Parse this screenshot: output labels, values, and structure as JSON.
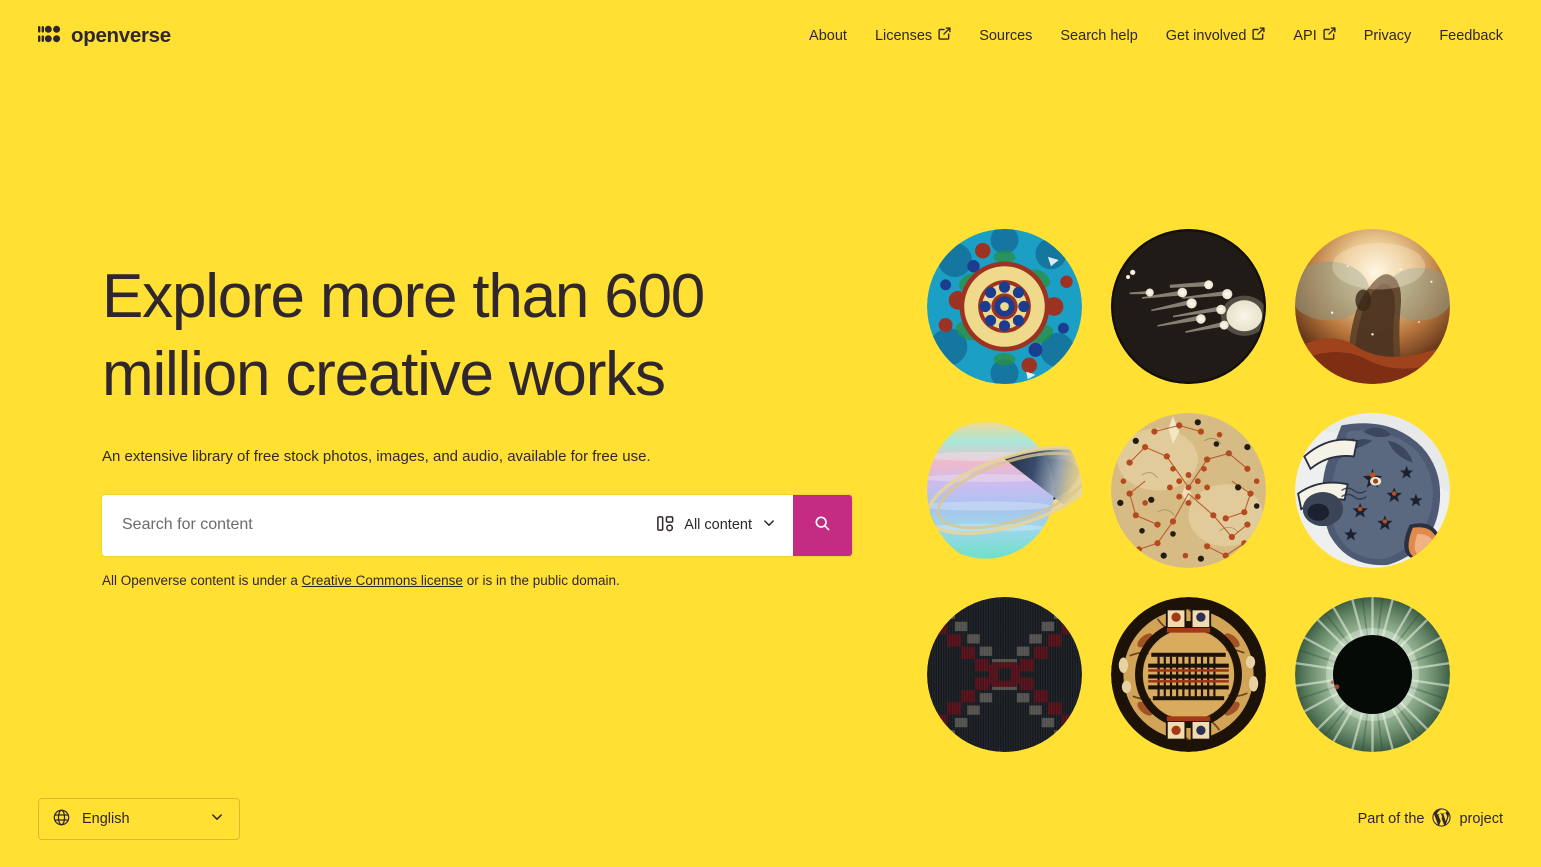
{
  "brand": {
    "name": "openverse",
    "logo_icon": "openverse-logo-icon"
  },
  "nav": {
    "items": [
      {
        "label": "About",
        "external": false
      },
      {
        "label": "Licenses",
        "external": true
      },
      {
        "label": "Sources",
        "external": false
      },
      {
        "label": "Search help",
        "external": false
      },
      {
        "label": "Get involved",
        "external": true
      },
      {
        "label": "API",
        "external": true
      },
      {
        "label": "Privacy",
        "external": false
      },
      {
        "label": "Feedback",
        "external": false
      }
    ]
  },
  "hero": {
    "title": "Explore more than 600 million creative works",
    "subtitle": "An extensive library of free stock photos, images, and audio, available for free use."
  },
  "search": {
    "placeholder": "Search for content",
    "value": "",
    "content_type_label": "All content",
    "content_type_icon": "content-switcher-icon",
    "chevron_icon": "chevron-down-icon",
    "submit_icon": "search-icon",
    "submit_color": "#c42c84"
  },
  "license_note": {
    "before": "All Openverse content is under a ",
    "link": "Creative Commons license",
    "after": " or is in the public domain."
  },
  "gallery": {
    "items": [
      {
        "name": "iznik-ceramic-plate",
        "alt": "Turquoise Iznik ceramic plate with floral medallion"
      },
      {
        "name": "comet-illustration",
        "alt": "Antique dark engraving of comets with bright heads and tails"
      },
      {
        "name": "carina-nebula",
        "alt": "Orange and brown nebula pillar lit from behind"
      },
      {
        "name": "ringed-planet",
        "alt": "Pastel rainbow ringed planet resembling Saturn"
      },
      {
        "name": "antique-star-chart",
        "alt": "Aged parchment star chart with red and black star dots"
      },
      {
        "name": "taurus-constellation",
        "alt": "Hand coloured engraving of the Taurus bull head with stars"
      },
      {
        "name": "woven-textile-x-pattern",
        "alt": "Woven textile with red and grey zigzag X on dark ground"
      },
      {
        "name": "circular-ornament-disc",
        "alt": "Ornate circular artifact with dark ring and painted panels"
      },
      {
        "name": "solar-eclipse",
        "alt": "Total solar eclipse with green corona rays"
      }
    ]
  },
  "footer": {
    "language": {
      "globe_icon": "globe-icon",
      "value": "English",
      "chevron_icon": "chevron-down-icon"
    },
    "credit": {
      "prefix": "Part of the",
      "logo_icon": "wordpress-logo-icon",
      "suffix": "project"
    }
  },
  "colors": {
    "background": "#ffe033",
    "text": "#30272e",
    "accent": "#c42c84"
  }
}
